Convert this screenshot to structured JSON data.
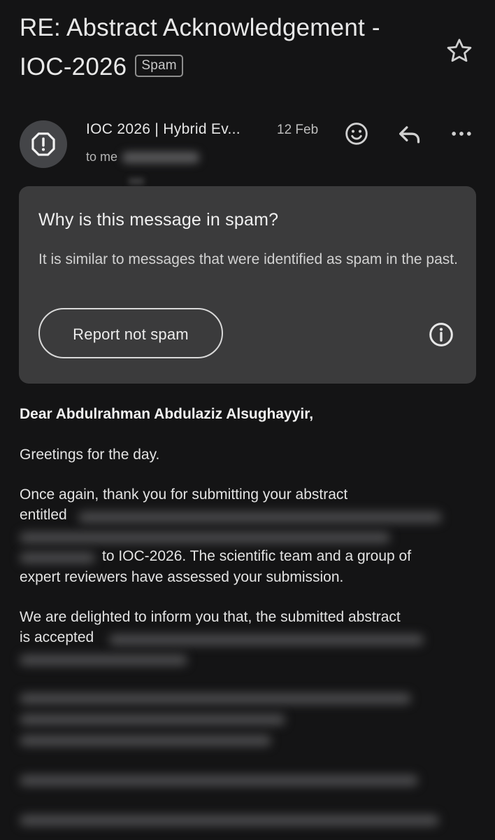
{
  "email": {
    "subject": "RE: Abstract Acknowledgement - IOC-2026",
    "label": "Spam",
    "sender": "IOC 2026 | Hybrid Ev...",
    "date": "12 Feb",
    "to_prefix": "to me"
  },
  "spam_notice": {
    "title": "Why is this message in spam?",
    "body": "It is similar to messages that were identified as spam in the past.",
    "report_button": "Report not spam"
  },
  "message": {
    "greeting": "Dear Abdulrahman Abdulaziz Alsughayyir,",
    "line1": "Greetings for the day.",
    "para2_start": "Once again, thank you for submitting your abstract",
    "para2_entitled": "entitled",
    "para2_end": "to IOC-2026. The scientific team and a group of",
    "para2_last": "expert reviewers have assessed your submission.",
    "para3_start": "We are delighted to inform you that, the submitted abstract",
    "para3_accepted": "is accepted"
  },
  "icons": {
    "star": "star-outline-icon",
    "avatar": "spam-alert-octagon-icon",
    "emoji": "emoji-smile-icon",
    "reply": "reply-arrow-icon",
    "more": "more-horizontal-icon",
    "info": "info-circle-icon"
  }
}
